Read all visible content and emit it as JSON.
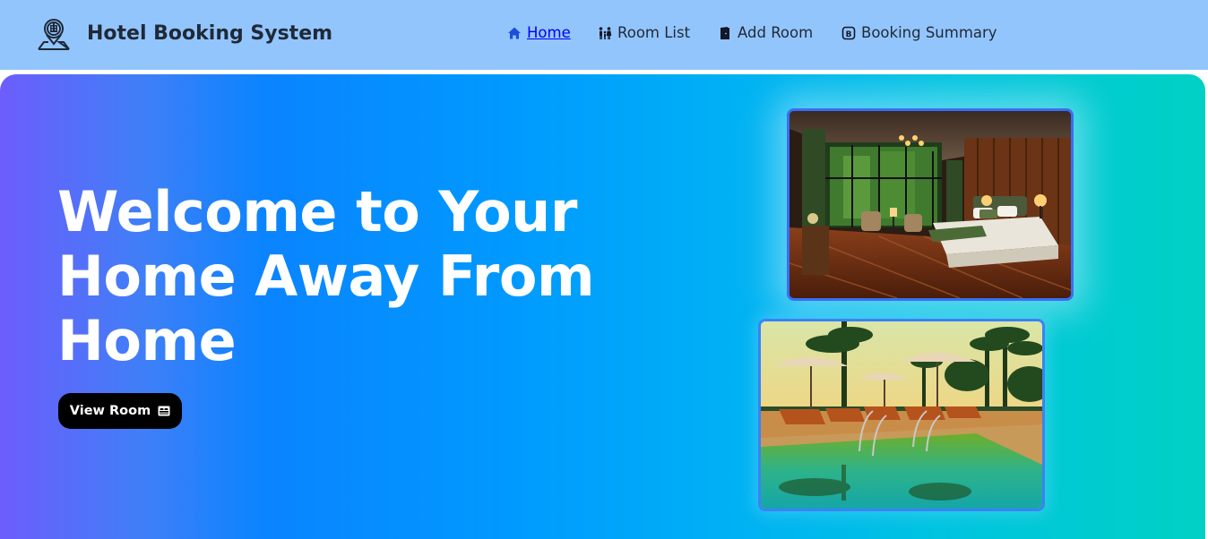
{
  "app": {
    "title": "Hotel Booking System",
    "logo_icon": "hotel-location-logo-icon"
  },
  "nav": {
    "items": [
      {
        "label": "Home",
        "icon": "home-icon",
        "active": true
      },
      {
        "label": "Room List",
        "icon": "family-icon",
        "active": false
      },
      {
        "label": "Add Room",
        "icon": "door-icon",
        "active": false
      },
      {
        "label": "Booking Summary",
        "icon": "b-badge-icon",
        "active": false
      }
    ]
  },
  "hero": {
    "title_lines": [
      "Welcome to Your",
      "Home Away From",
      "Home"
    ],
    "button_label": "View Room",
    "button_icon": "bed-icon",
    "images": [
      {
        "subject": "hotel-bedroom-photo"
      },
      {
        "subject": "resort-pool-photo"
      }
    ]
  },
  "colors": {
    "navbar_bg": "#93c5fd",
    "nav_active": "#0000ee",
    "hero_gradient": [
      "#6d5dfc",
      "#0a84ff",
      "#00b0f5",
      "#00d1c4"
    ],
    "button_bg": "#000000",
    "image_border": "#3b82f6"
  }
}
